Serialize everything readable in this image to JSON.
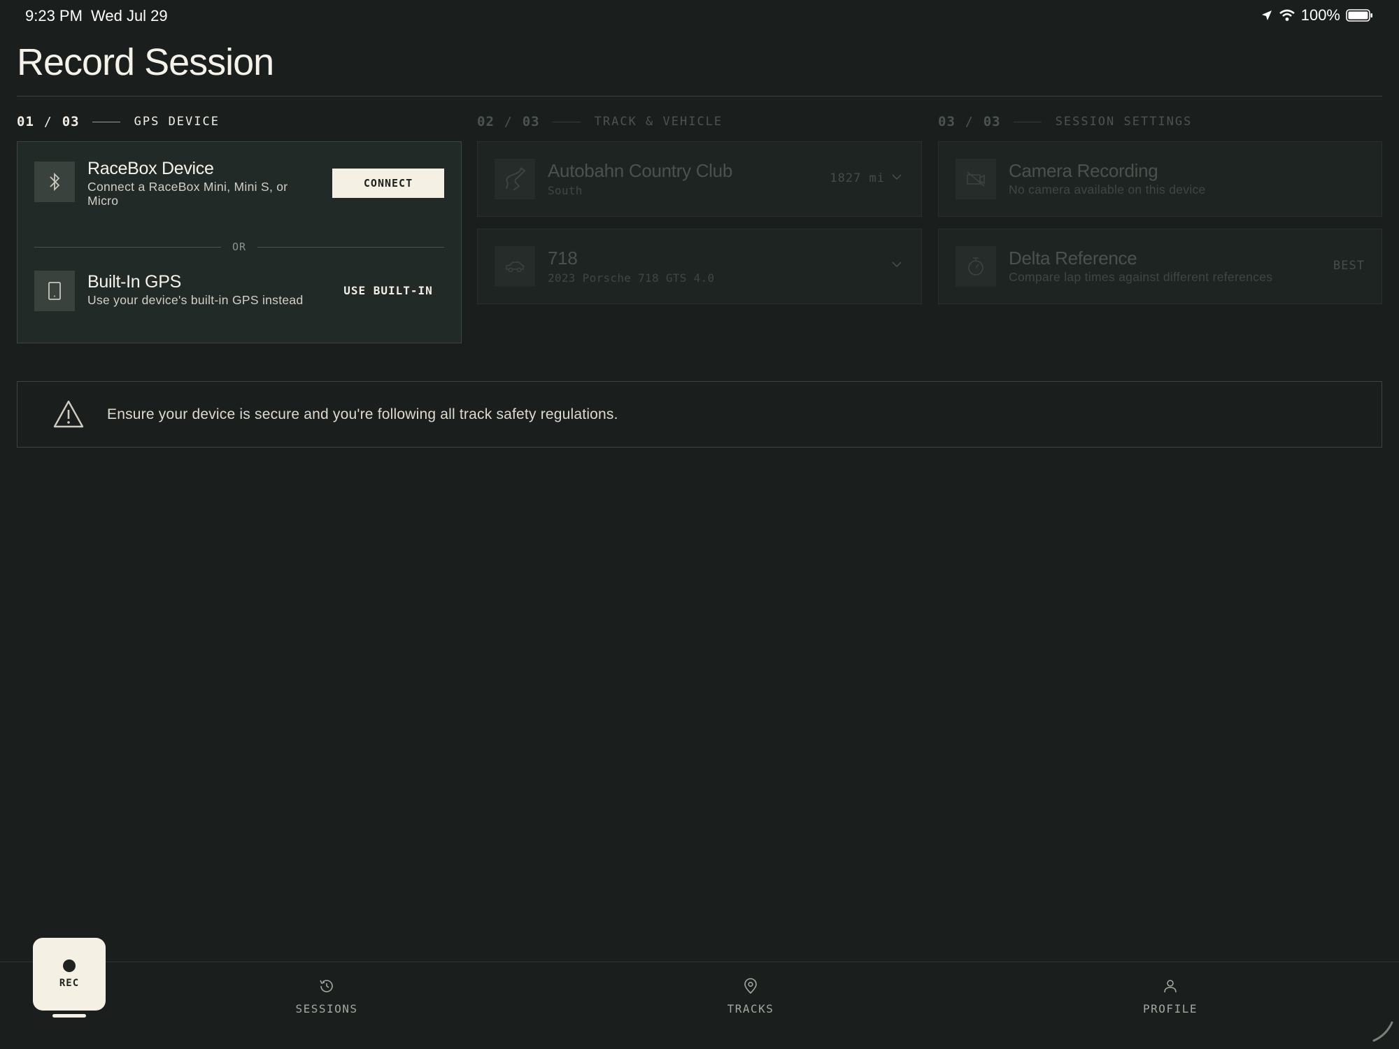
{
  "status_bar": {
    "time": "9:23 PM",
    "date": "Wed Jul 29",
    "battery": "100%"
  },
  "page": {
    "title": "Record Session"
  },
  "steps": [
    {
      "num": "01",
      "total": "03",
      "label": "GPS DEVICE"
    },
    {
      "num": "02",
      "total": "03",
      "label": "TRACK & VEHICLE"
    },
    {
      "num": "03",
      "total": "03",
      "label": "SESSION SETTINGS"
    }
  ],
  "gps": {
    "racebox": {
      "title": "RaceBox Device",
      "subtitle_line1": "Connect a RaceBox Mini, Mini S, or",
      "subtitle_line2": "Micro",
      "button": "CONNECT"
    },
    "or": "OR",
    "builtin": {
      "title": "Built-In GPS",
      "subtitle": "Use your device's built-in GPS instead",
      "button": "USE BUILT-IN"
    }
  },
  "track": {
    "name": "Autobahn Country Club",
    "config": "South",
    "distance": "1827 mi"
  },
  "vehicle": {
    "name": "718",
    "detail": "2023 Porsche 718 GTS 4.0"
  },
  "camera": {
    "title": "Camera Recording",
    "subtitle": "No camera available on this device"
  },
  "delta": {
    "title": "Delta Reference",
    "subtitle": "Compare lap times against different references",
    "value": "BEST"
  },
  "warning": {
    "text": "Ensure your device is secure and you're following all track safety regulations."
  },
  "nav": {
    "rec": "REC",
    "sessions": "SESSIONS",
    "tracks": "TRACKS",
    "profile": "PROFILE"
  },
  "colors": {
    "background": "#1a1f1d",
    "accent": "#f4f0e4",
    "card": "#222a27"
  }
}
